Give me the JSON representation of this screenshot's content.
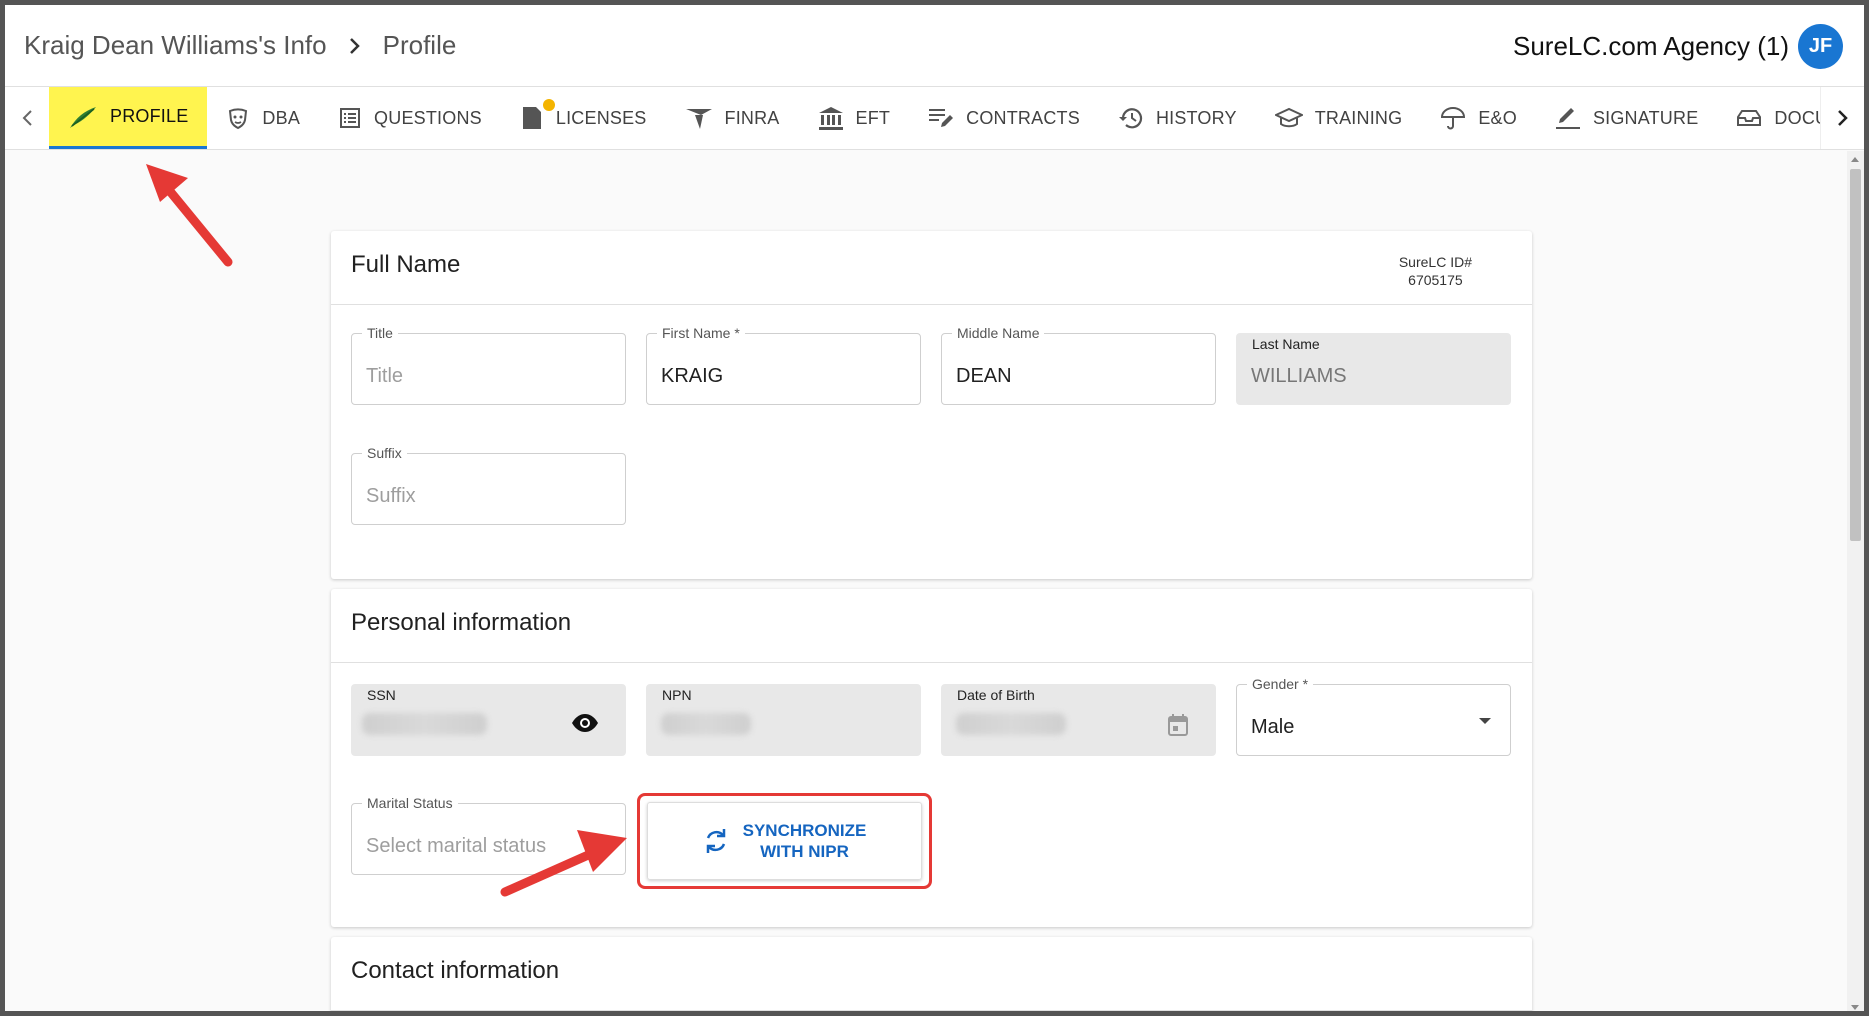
{
  "breadcrumb": {
    "parent": "Kraig Dean Williams's Info",
    "current": "Profile"
  },
  "agency": "SureLC.com Agency (1)",
  "avatar_initials": "JF",
  "tabs": [
    {
      "label": "PROFILE",
      "icon": "feather-icon",
      "active": true
    },
    {
      "label": "DBA",
      "icon": "mask-icon"
    },
    {
      "label": "QUESTIONS",
      "icon": "list-icon"
    },
    {
      "label": "LICENSES",
      "icon": "license-icon",
      "badge": true
    },
    {
      "label": "FINRA",
      "icon": "finra-icon"
    },
    {
      "label": "EFT",
      "icon": "bank-icon"
    },
    {
      "label": "CONTRACTS",
      "icon": "edit-list-icon"
    },
    {
      "label": "HISTORY",
      "icon": "history-icon"
    },
    {
      "label": "TRAINING",
      "icon": "graduation-cap-icon"
    },
    {
      "label": "E&O",
      "icon": "umbrella-icon"
    },
    {
      "label": "SIGNATURE",
      "icon": "pen-icon"
    },
    {
      "label": "DOCUMENTS",
      "icon": "inbox-icon"
    }
  ],
  "full_name": {
    "title": "Full Name",
    "id_label": "SureLC ID#",
    "id_value": "6705175",
    "fields": {
      "title": {
        "label": "Title",
        "placeholder": "Title"
      },
      "first_name": {
        "label": "First Name *",
        "value": "KRAIG"
      },
      "middle_name": {
        "label": "Middle Name",
        "value": "DEAN"
      },
      "last_name": {
        "label": "Last Name",
        "value": "WILLIAMS"
      },
      "suffix": {
        "label": "Suffix",
        "placeholder": "Suffix"
      }
    }
  },
  "personal": {
    "title": "Personal information",
    "ssn_label": "SSN",
    "npn_label": "NPN",
    "dob_label": "Date of Birth",
    "gender_label": "Gender *",
    "gender_value": "Male",
    "marital_label": "Marital Status",
    "marital_placeholder": "Select marital status",
    "sync_line1": "SYNCHRONIZE",
    "sync_line2": "WITH NIPR"
  },
  "contact": {
    "title": "Contact information"
  },
  "colors": {
    "accent": "#1976d2",
    "active_tab": "#fff44f",
    "annotation": "#e53935"
  }
}
